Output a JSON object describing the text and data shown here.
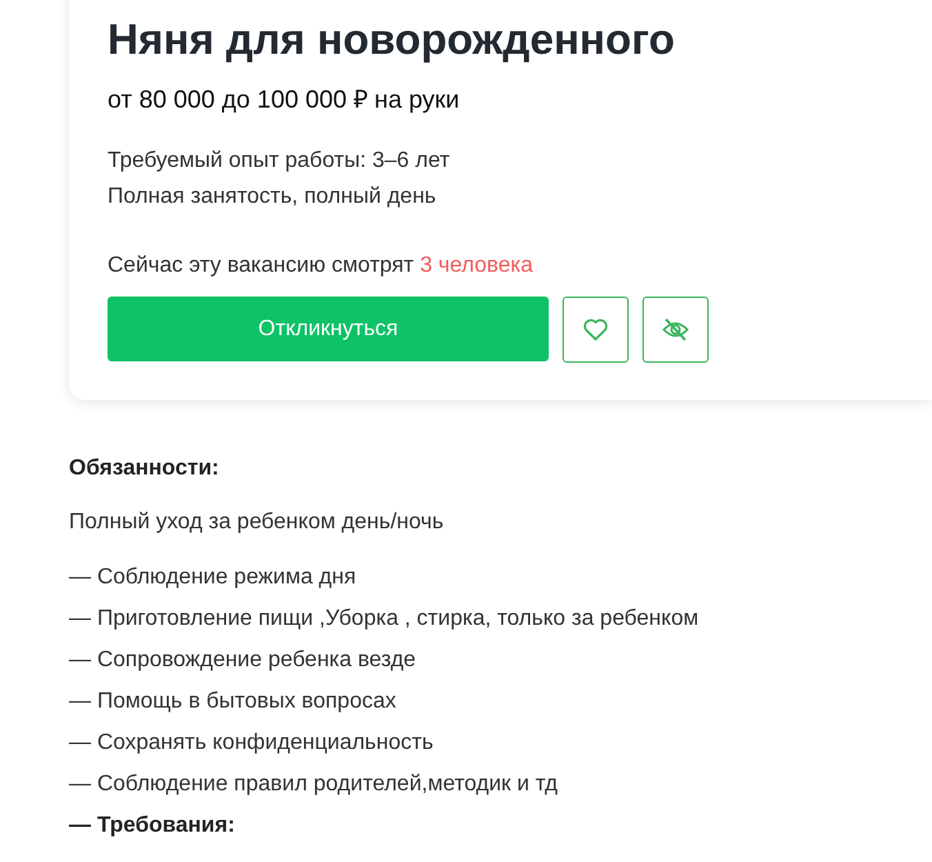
{
  "vacancy": {
    "title": "Няня для новорожденного",
    "salary": "от 80 000 до 100 000 ₽ на руки",
    "details": [
      "Требуемый опыт работы: 3–6 лет",
      "Полная занятость, полный день"
    ],
    "viewers": {
      "text": "Сейчас эту вакансию смотрят",
      "count": "3 человека"
    },
    "respond_button": "Откликнуться"
  },
  "description": {
    "heading": "Обязанности:",
    "intro": "Полный уход за ребенком день/ночь",
    "items": [
      {
        "text": "— Соблюдение режима дня",
        "bold": false
      },
      {
        "text": "— Приготовление пищи ,Уборка , стирка, только за ребенком",
        "bold": false
      },
      {
        "text": "— Сопровождение ребенка везде",
        "bold": false
      },
      {
        "text": "— Помощь в бытовых вопросах",
        "bold": false
      },
      {
        "text": "— Сохранять конфиденциальность",
        "bold": false
      },
      {
        "text": "— Соблюдение правил родителей,методик и тд",
        "bold": false
      },
      {
        "text": "— Требования:",
        "bold": true
      }
    ]
  }
}
